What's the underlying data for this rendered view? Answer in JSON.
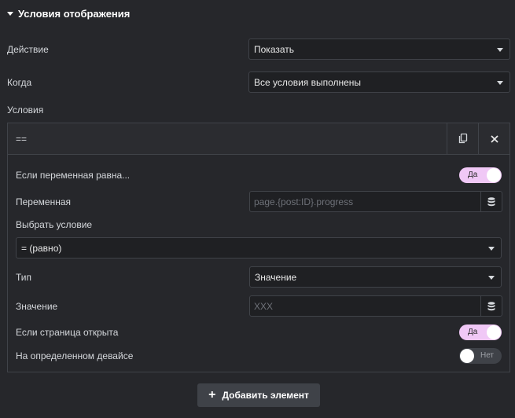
{
  "section": {
    "title": "Условия отображения"
  },
  "action": {
    "label": "Действие",
    "value": "Показать"
  },
  "when": {
    "label": "Когда",
    "value": "Все условия выполнены"
  },
  "conditions": {
    "label": "Условия",
    "item": {
      "title": "==",
      "variable_equals": {
        "label": "Если переменная равна...",
        "toggle_text": "Да",
        "enabled": true
      },
      "variable": {
        "label": "Переменная",
        "placeholder": "page.{post:ID}.progress",
        "value": ""
      },
      "select_condition": {
        "label": "Выбрать условие",
        "value": "= (равно)"
      },
      "type": {
        "label": "Тип",
        "value": "Значение"
      },
      "value_field": {
        "label": "Значение",
        "placeholder": "XXX",
        "value": ""
      },
      "page_open": {
        "label": "Если страница открыта",
        "toggle_text": "Да",
        "enabled": true
      },
      "device": {
        "label": "На определенном девайсе",
        "toggle_text": "Нет",
        "enabled": false
      }
    }
  },
  "add_button": {
    "label": "Добавить элемент",
    "icon": "plus-icon"
  },
  "colors": {
    "background": "#26272b",
    "input_bg": "#1f2023",
    "border": "#404349",
    "toggle_on": "#f0c8f6",
    "toggle_off": "#3f4248",
    "button_bg": "#3f4248"
  }
}
